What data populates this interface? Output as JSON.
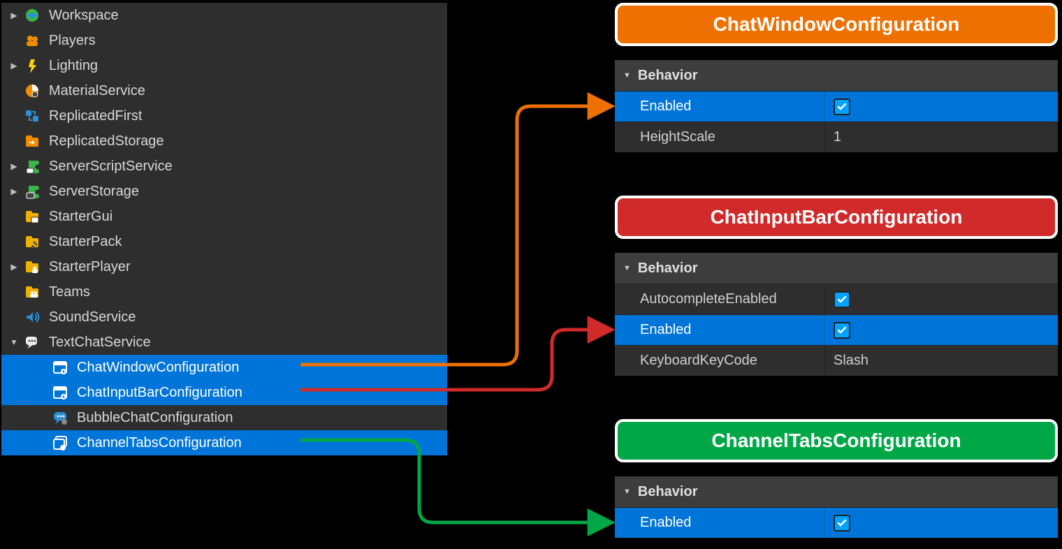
{
  "explorer": {
    "items": [
      {
        "label": "Workspace",
        "expand": "▶",
        "icon": "workspace-icon"
      },
      {
        "label": "Players",
        "expand": "",
        "icon": "players-icon"
      },
      {
        "label": "Lighting",
        "expand": "▶",
        "icon": "lighting-icon"
      },
      {
        "label": "MaterialService",
        "expand": "",
        "icon": "material-icon"
      },
      {
        "label": "ReplicatedFirst",
        "expand": "",
        "icon": "replicatedfirst-icon"
      },
      {
        "label": "ReplicatedStorage",
        "expand": "",
        "icon": "replicatedstorage-icon"
      },
      {
        "label": "ServerScriptService",
        "expand": "▶",
        "icon": "serverscript-icon"
      },
      {
        "label": "ServerStorage",
        "expand": "▶",
        "icon": "serverstorage-icon"
      },
      {
        "label": "StarterGui",
        "expand": "",
        "icon": "startergui-icon"
      },
      {
        "label": "StarterPack",
        "expand": "",
        "icon": "starterpack-icon"
      },
      {
        "label": "StarterPlayer",
        "expand": "▶",
        "icon": "starterplayer-icon"
      },
      {
        "label": "Teams",
        "expand": "",
        "icon": "teams-icon"
      },
      {
        "label": "SoundService",
        "expand": "",
        "icon": "sound-icon"
      },
      {
        "label": "TextChatService",
        "expand": "▼",
        "icon": "textchat-icon"
      }
    ],
    "children": [
      {
        "label": "ChatWindowConfiguration",
        "icon": "config-icon",
        "selected": true
      },
      {
        "label": "ChatInputBarConfiguration",
        "icon": "config-icon",
        "selected": true
      },
      {
        "label": "BubbleChatConfiguration",
        "icon": "bubble-icon",
        "selected": false
      },
      {
        "label": "ChannelTabsConfiguration",
        "icon": "tabs-icon",
        "selected": true
      }
    ]
  },
  "panels": {
    "cw": {
      "title": "ChatWindowConfiguration",
      "section": "Behavior",
      "rows": [
        {
          "key": "Enabled",
          "type": "check",
          "checked": true,
          "hl": true
        },
        {
          "key": "HeightScale",
          "type": "text",
          "value": "1",
          "hl": false
        }
      ]
    },
    "ci": {
      "title": "ChatInputBarConfiguration",
      "section": "Behavior",
      "rows": [
        {
          "key": "AutocompleteEnabled",
          "type": "check",
          "checked": true,
          "hl": false
        },
        {
          "key": "Enabled",
          "type": "check",
          "checked": true,
          "hl": true
        },
        {
          "key": "KeyboardKeyCode",
          "type": "text",
          "value": "Slash",
          "hl": false
        }
      ]
    },
    "ct": {
      "title": "ChannelTabsConfiguration",
      "section": "Behavior",
      "rows": [
        {
          "key": "Enabled",
          "type": "check",
          "checked": true,
          "hl": true
        }
      ]
    }
  },
  "colors": {
    "orange": "#ee7000",
    "red": "#d12a2a",
    "green": "#00a746"
  }
}
